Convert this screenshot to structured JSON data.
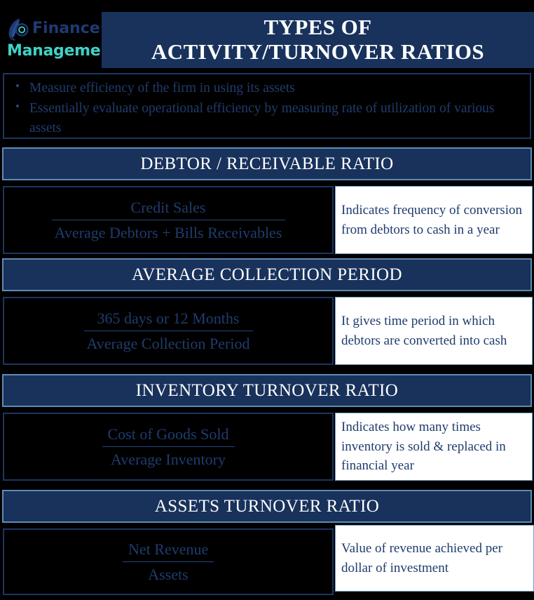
{
  "brand": {
    "icon": "graduation-cap-icon",
    "word1": "Finance",
    "word2": "Management",
    "color1": "#1f3a74",
    "color2": "#3fd3c6"
  },
  "header": {
    "title_line1": "TYPES OF",
    "title_line2": "ACTIVITY/TURNOVER RATIOS",
    "background": "#18325c",
    "text_color": "#ffffff"
  },
  "intro": {
    "bullets": [
      "Measure efficiency of the firm in using its assets",
      "Essentially evaluate operational efficiency by measuring rate of utilization of various assets"
    ],
    "text_color": "#1f3c6d",
    "background": "#000000"
  },
  "sections": [
    {
      "heading": "DEBTOR / RECEIVABLE RATIO",
      "formula": {
        "numerator": "Credit Sales",
        "denominator": "Average Debtors + Bills Receivables"
      },
      "description": "Indicates frequency of conversion from debtors to cash in a year"
    },
    {
      "heading": "AVERAGE COLLECTION PERIOD",
      "formula": {
        "numerator": "365 days or 12 Months",
        "denominator": "Average Collection Period"
      },
      "description": "It gives  time period in which debtors are converted into cash"
    },
    {
      "heading": "INVENTORY TURNOVER RATIO",
      "formula": {
        "numerator": "Cost of Goods Sold",
        "denominator": "Average Inventory"
      },
      "description": "Indicates how many times inventory is sold & replaced in financial year"
    },
    {
      "heading": "ASSETS TURNOVER RATIO",
      "formula": {
        "numerator": "Net Revenue",
        "denominator": "Assets"
      },
      "description": "Value of revenue achieved per dollar of investment"
    }
  ],
  "theme": {
    "navy": "#18325c",
    "navy_border": "#1d3562",
    "light_blue_border": "#5d8cb5",
    "text_navy": "#1f3c6d",
    "black": "#000000",
    "white": "#ffffff"
  }
}
